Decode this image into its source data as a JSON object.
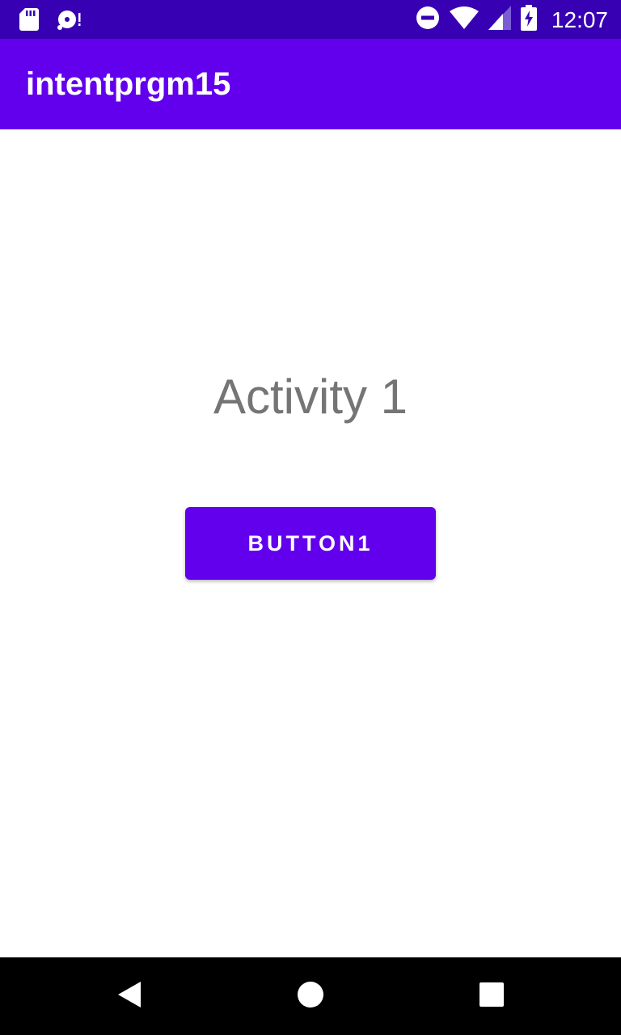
{
  "status_bar": {
    "time": "12:07",
    "left_icons": [
      "sd-card-icon",
      "disc-sync-icon"
    ],
    "right_icons": [
      "do-not-disturb-icon",
      "wifi-icon",
      "cell-signal-icon",
      "battery-charging-icon"
    ]
  },
  "app_bar": {
    "title": "intentprgm15"
  },
  "main": {
    "activity_label": "Activity 1",
    "button_label": "BUTTON1"
  },
  "nav_bar": {
    "buttons": [
      "back-icon",
      "home-icon",
      "recents-icon"
    ]
  },
  "colors": {
    "status_bar": "#3700b3",
    "primary": "#6200ee",
    "text_secondary": "#757575",
    "nav_bar": "#000000"
  }
}
